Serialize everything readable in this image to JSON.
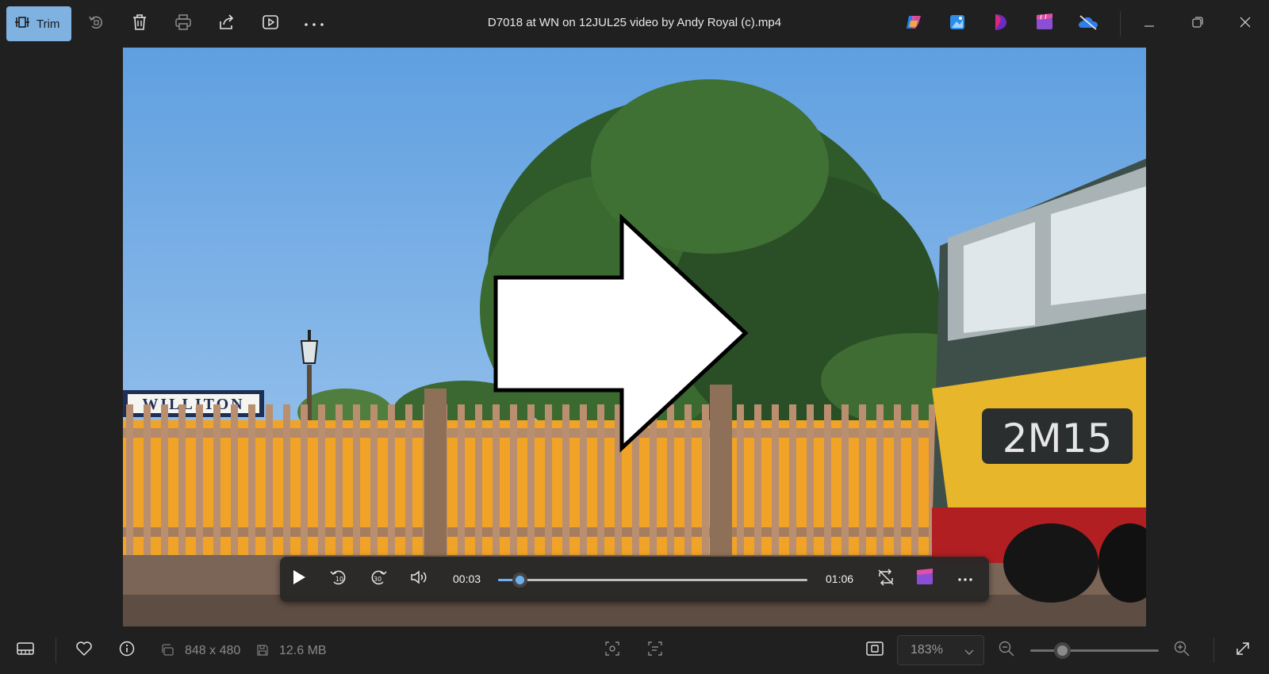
{
  "toolbar": {
    "trim_label": "Trim",
    "icons": [
      "rotate-icon",
      "delete-icon",
      "print-icon",
      "share-icon",
      "slideshow-icon",
      "more-icon"
    ],
    "accent_color": "#7fb2e0"
  },
  "window": {
    "title": "D7018 at WN on 12JUL25 video by Andy Royal (c).mp4",
    "app_icons": [
      "copilot-icon",
      "photos-editor-icon",
      "clipchamp-icon",
      "movie-maker-icon",
      "onedrive-icon"
    ],
    "controls": [
      "minimize-icon",
      "restore-icon",
      "close-icon"
    ]
  },
  "video": {
    "station_sign": "WILLITON",
    "loco_headcode": "2M15"
  },
  "player": {
    "current_time": "00:03",
    "total_time": "01:06",
    "progress_fraction": 0.07
  },
  "status": {
    "dimensions": "848 x 480",
    "file_size": "12.6 MB",
    "zoom_level": "183%",
    "zoom_slider_fraction": 0.25
  }
}
